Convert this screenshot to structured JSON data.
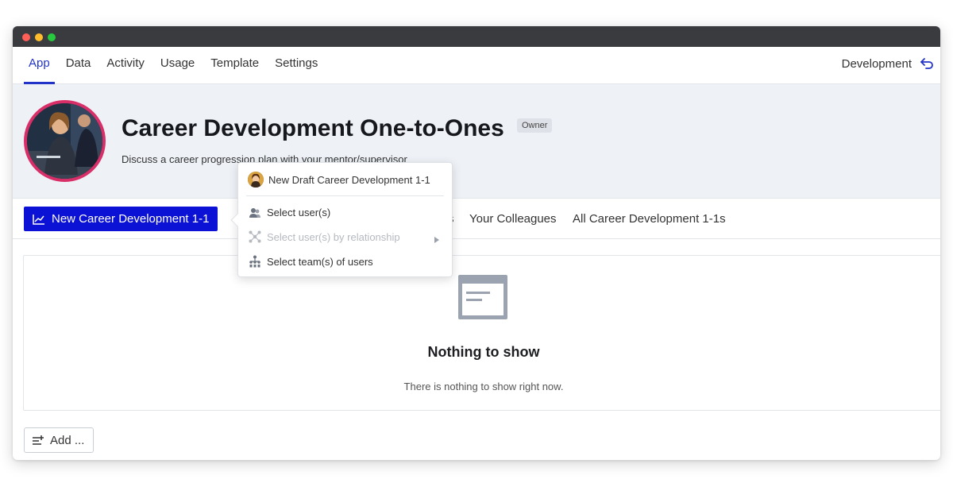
{
  "nav": {
    "tabs": [
      "App",
      "Data",
      "Activity",
      "Usage",
      "Template",
      "Settings"
    ],
    "active_tab": "App",
    "environment_label": "Development"
  },
  "header": {
    "title": "Career Development One-to-Ones",
    "badge": "Owner",
    "description": "Discuss a career progression plan with your mentor/supervisor"
  },
  "actions": {
    "primary_button": "New Career Development 1-1",
    "partial_tab": "s",
    "tabs": [
      "Your Colleagues",
      "All Career Development 1-1s"
    ]
  },
  "popup": {
    "items": [
      {
        "label": "New Draft Career Development 1-1"
      },
      {
        "label": "Select user(s)"
      },
      {
        "label": "Select user(s) by relationship"
      },
      {
        "label": "Select team(s) of users"
      }
    ]
  },
  "empty_state": {
    "title": "Nothing to show",
    "text": "There is nothing to show right now."
  },
  "footer": {
    "add_button": "Add ..."
  },
  "colors": {
    "accent": "#0b12d6",
    "active_tab": "#2233c8",
    "avatar_ring": "#d92f68",
    "header_bg": "#eef2f7"
  }
}
